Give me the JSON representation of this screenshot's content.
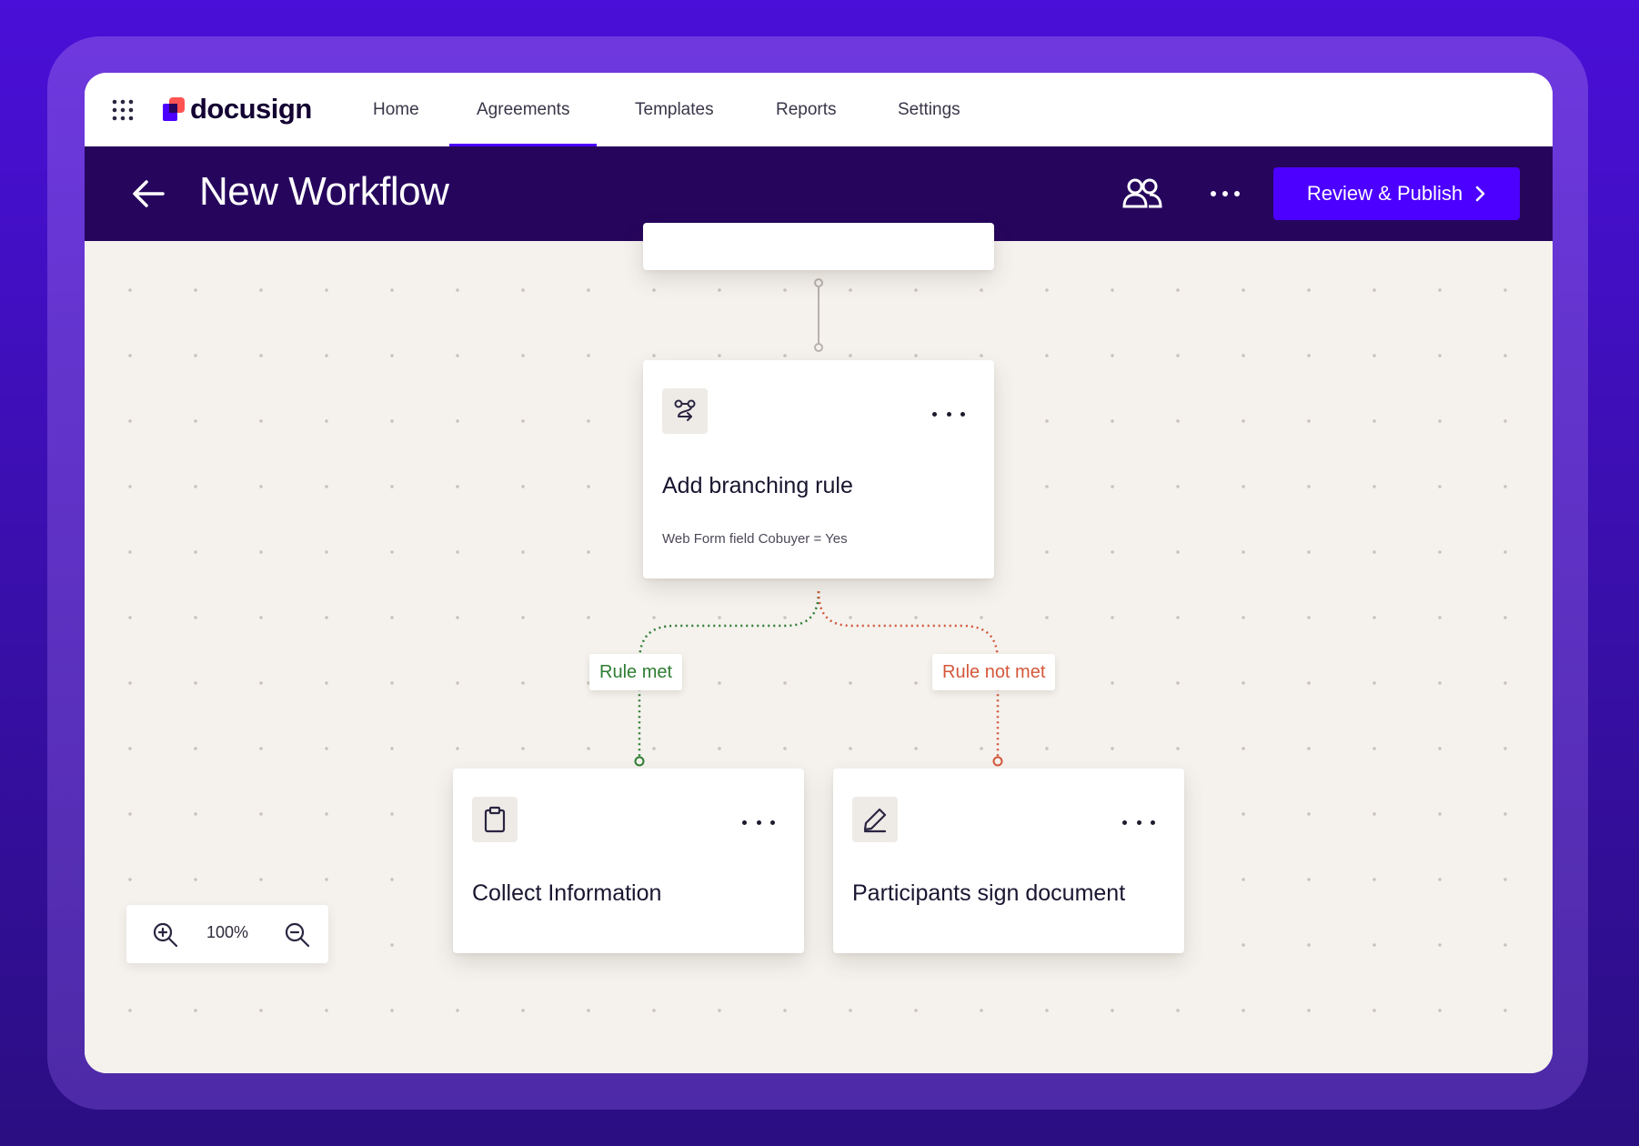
{
  "nav": {
    "logo_text": "docusign",
    "items": [
      {
        "label": "Home"
      },
      {
        "label": "Agreements",
        "active": true
      },
      {
        "label": "Templates"
      },
      {
        "label": "Reports"
      },
      {
        "label": "Settings"
      }
    ]
  },
  "header": {
    "title": "New Workflow",
    "publish_label": "Review & Publish"
  },
  "canvas": {
    "branch_card": {
      "title": "Add branching rule",
      "subtitle": "Web Form field  Cobuyer = Yes"
    },
    "rule_met_label": "Rule met",
    "rule_not_met_label": "Rule not met",
    "cards": [
      {
        "title": "Collect Information",
        "icon": "clipboard-icon"
      },
      {
        "title": "Participants sign document",
        "icon": "pen-icon"
      }
    ],
    "zoom": {
      "level": "100%"
    }
  },
  "colors": {
    "accent": "#4c00ff",
    "header_bg": "#26065d",
    "rule_met": "#2e7d32",
    "rule_not_met": "#d4573a"
  }
}
